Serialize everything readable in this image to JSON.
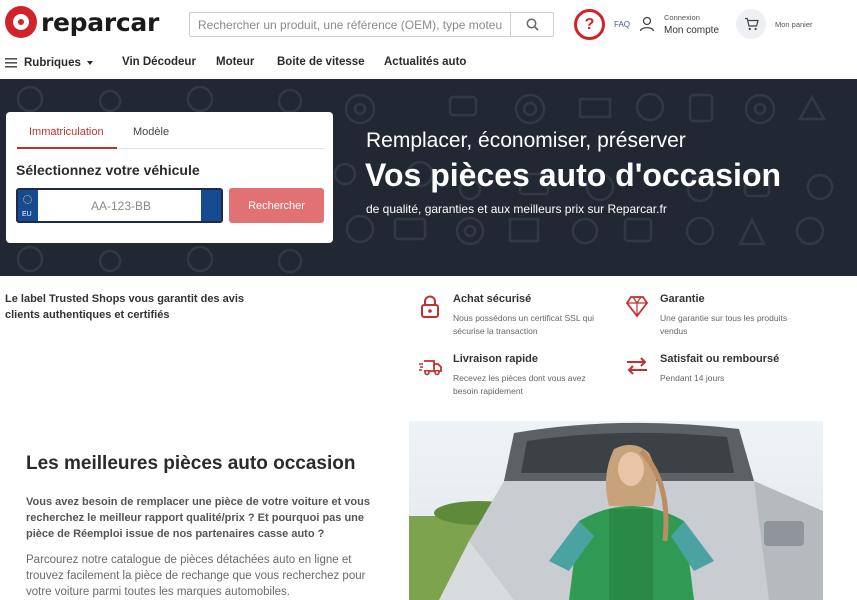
{
  "brand": {
    "name": "reparcar",
    "color": "#d1232a"
  },
  "search": {
    "placeholder": "Rechercher un produit, une référence (OEM), type moteur / boite",
    "icon": "search-icon"
  },
  "header": {
    "faq_symbol": "?",
    "faq_label": "FAQ",
    "account_small": "Connexion",
    "account_big": "Mon compte",
    "cart_label": "Mon panier"
  },
  "nav": {
    "rubriques": "Rubriques",
    "items": [
      "Vin Décodeur",
      "Moteur",
      "Boite de vitesse",
      "Actualités auto"
    ]
  },
  "hero": {
    "subtitle": "Remplacer, économiser, préserver",
    "title": "Vos pièces auto d'occasion",
    "description": "de qualité, garanties et aux meilleurs prix sur Reparcar.fr",
    "background": "#222833"
  },
  "vehicle_search": {
    "tabs": [
      "Immatriculation",
      "Modèle"
    ],
    "active_tab": "Immatriculation",
    "title": "Sélectionnez votre véhicule",
    "plate_country": "EU",
    "plate_placeholder": "AA-123-BB",
    "button": "Rechercher",
    "button_color": "#e27173"
  },
  "trust": {
    "label_text": "Le label Trusted Shops vous garantit des avis clients authentiques et certifiés",
    "features": [
      {
        "icon": "lock-icon",
        "title": "Achat sécurisé",
        "desc": "Nous possédons un certificat SSL qui sécurise la transaction"
      },
      {
        "icon": "diamond-icon",
        "title": "Garantie",
        "desc": "Une garantie sur tous les produits vendus"
      },
      {
        "icon": "delivery-truck-icon",
        "title": "Livraison rapide",
        "desc": "Recevez les pièces dont vous avez besoin rapidement"
      },
      {
        "icon": "exchange-arrows-icon",
        "title": "Satisfait ou remboursé",
        "desc": "Pendant 14 jours"
      }
    ]
  },
  "content": {
    "title": "Les meilleures pièces auto occasion",
    "lead": "Vous avez besoin de remplacer une pièce de votre voiture et vous recherchez le meilleur rapport qualité/prix ? Et pourquoi pas une pièce de Réemploi issue de nos partenaires casse auto ?",
    "body": "Parcourez notre catalogue de pièces détachées auto en ligne et trouvez facilement la pièce de rechange que vous recherchez pour votre voiture parmi toutes les marques automobiles."
  }
}
